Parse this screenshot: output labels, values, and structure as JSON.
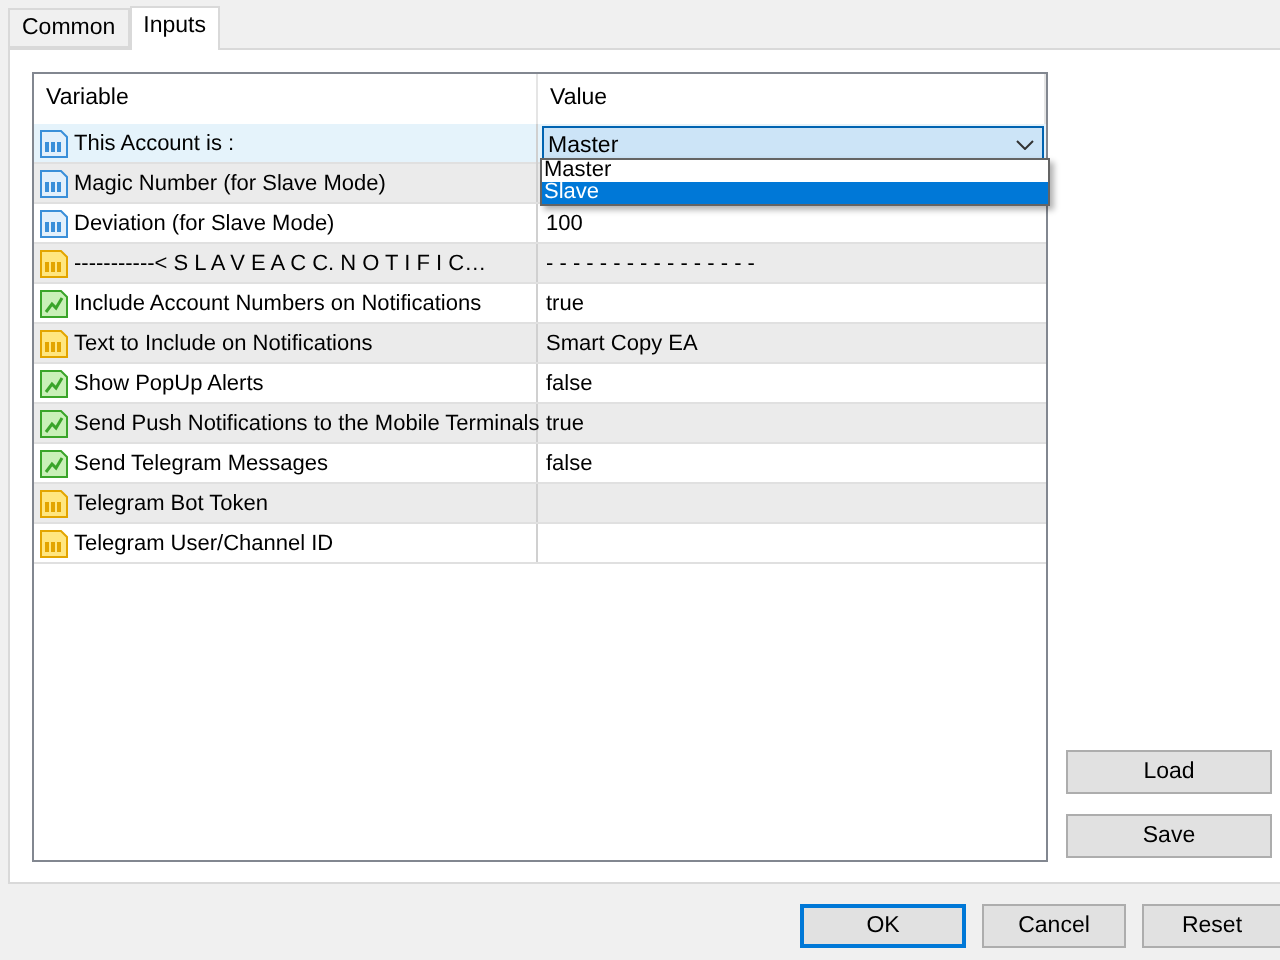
{
  "tabs": [
    {
      "label": "Common",
      "selected": false
    },
    {
      "label": "Inputs",
      "selected": true
    }
  ],
  "table": {
    "columns": [
      "Variable",
      "Value"
    ],
    "rows": [
      {
        "kind": "number",
        "variable": "This Account is :",
        "value": "Master",
        "selected": true,
        "editing": true
      },
      {
        "kind": "number",
        "variable": "Magic Number (for Slave Mode)",
        "value": "",
        "selected": false,
        "editing": false
      },
      {
        "kind": "number",
        "variable": "Deviation (for Slave Mode)",
        "value": "100",
        "selected": false,
        "editing": false
      },
      {
        "kind": "string",
        "variable": "-----------< S L A V E   A C C.   N O T I F I C…",
        "value": "- - - - - - - - - - - - - - - -",
        "selected": false,
        "editing": false
      },
      {
        "kind": "bool",
        "variable": "Include Account Numbers on Notifications",
        "value": "true",
        "selected": false,
        "editing": false
      },
      {
        "kind": "string",
        "variable": "Text to Include on Notifications",
        "value": "Smart Copy EA",
        "selected": false,
        "editing": false
      },
      {
        "kind": "bool",
        "variable": "Show PopUp Alerts",
        "value": "false",
        "selected": false,
        "editing": false
      },
      {
        "kind": "bool",
        "variable": "Send Push Notifications to the Mobile Terminals",
        "value": "true",
        "selected": false,
        "editing": false
      },
      {
        "kind": "bool",
        "variable": "Send Telegram Messages",
        "value": "false",
        "selected": false,
        "editing": false
      },
      {
        "kind": "string",
        "variable": "Telegram Bot Token",
        "value": "",
        "selected": false,
        "editing": false
      },
      {
        "kind": "string",
        "variable": "Telegram User/Channel ID",
        "value": "",
        "selected": false,
        "editing": false
      }
    ]
  },
  "dropdown": {
    "options": [
      {
        "label": "Master",
        "selected": false
      },
      {
        "label": "Slave",
        "selected": true
      }
    ]
  },
  "side_buttons": [
    "Load",
    "Save"
  ],
  "buttons": [
    {
      "label": "OK",
      "default": true
    },
    {
      "label": "Cancel",
      "default": false
    },
    {
      "label": "Reset",
      "default": false
    }
  ]
}
